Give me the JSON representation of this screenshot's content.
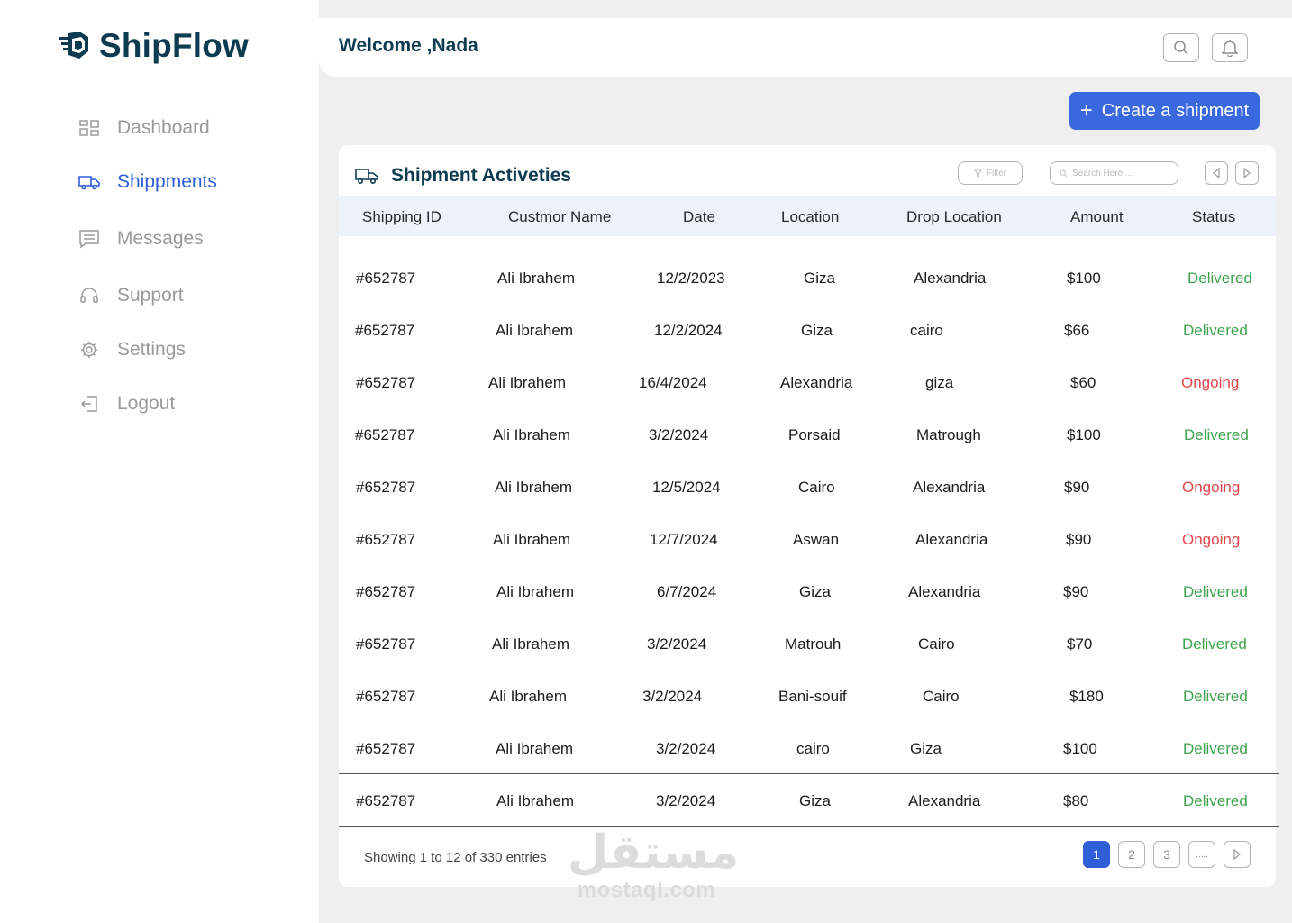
{
  "brand": {
    "name": "ShipFlow"
  },
  "sidebar": {
    "items": [
      {
        "label": "Dashboard",
        "icon": "dashboard-icon",
        "active": false
      },
      {
        "label": "Shippments",
        "icon": "truck-icon",
        "active": true
      },
      {
        "label": "Messages",
        "icon": "message-icon",
        "active": false
      },
      {
        "label": "Support",
        "icon": "headset-icon",
        "active": false
      },
      {
        "label": "Settings",
        "icon": "gear-icon",
        "active": false
      },
      {
        "label": "Logout",
        "icon": "logout-icon",
        "active": false
      }
    ]
  },
  "header": {
    "welcome": "Welcome ,Nada"
  },
  "actions": {
    "create_label": "Create a shipment"
  },
  "table": {
    "title": "Shipment Activeties",
    "filter_label": "Filter",
    "search_placeholder": "Search Here ...",
    "columns": [
      "Shipping ID",
      "Custmor Name",
      "Date",
      "Location",
      "Drop Location",
      "Amount",
      "Status"
    ],
    "rows": [
      [
        "#652787",
        "Ali Ibrahem",
        "12/2/2023",
        "Giza",
        "Alexandria",
        "$100",
        "Delivered"
      ],
      [
        "#652787",
        "Ali Ibrahem",
        "12/2/2024",
        "Giza",
        "cairo",
        "$66",
        "Delivered"
      ],
      [
        "#652787",
        "Ali Ibrahem",
        "16/4/2024",
        "Alexandria",
        "giza",
        "$60",
        "Ongoing"
      ],
      [
        "#652787",
        "Ali Ibrahem",
        "3/2/2024",
        "Porsaid",
        "Matrough",
        "$100",
        "Delivered"
      ],
      [
        "#652787",
        "Ali Ibrahem",
        "12/5/2024",
        "Cairo",
        "Alexandria",
        "$90",
        "Ongoing"
      ],
      [
        "#652787",
        "Ali Ibrahem",
        "12/7/2024",
        "Aswan",
        "Alexandria",
        "$90",
        "Ongoing"
      ],
      [
        "#652787",
        "Ali Ibrahem",
        "6/7/2024",
        "Giza",
        "Alexandria",
        "$90",
        "Delivered"
      ],
      [
        "#652787",
        "Ali Ibrahem",
        "3/2/2024",
        "Matrouh",
        "Cairo",
        "$70",
        "Delivered"
      ],
      [
        "#652787",
        "Ali Ibrahem",
        "3/2/2024",
        "Bani-souif",
        "Cairo",
        "$180",
        "Delivered"
      ],
      [
        "#652787",
        "Ali Ibrahem",
        "3/2/2024",
        "cairo",
        "Giza",
        "$100",
        "Delivered"
      ],
      [
        "#652787",
        "Ali Ibrahem",
        "3/2/2024",
        "Giza",
        "Alexandria",
        "$80",
        "Delivered"
      ]
    ],
    "showing": "Showing 1 to 12 of 330 entries",
    "pages": [
      "1",
      "2",
      "3",
      "....."
    ],
    "current_page": "1"
  },
  "colors": {
    "brand": "#0d3b52",
    "accent": "#3a68df",
    "delivered": "#3fa34d",
    "ongoing": "#e0474c"
  },
  "watermark": {
    "arabic": "مستقل",
    "latin": "mostaql.com"
  }
}
